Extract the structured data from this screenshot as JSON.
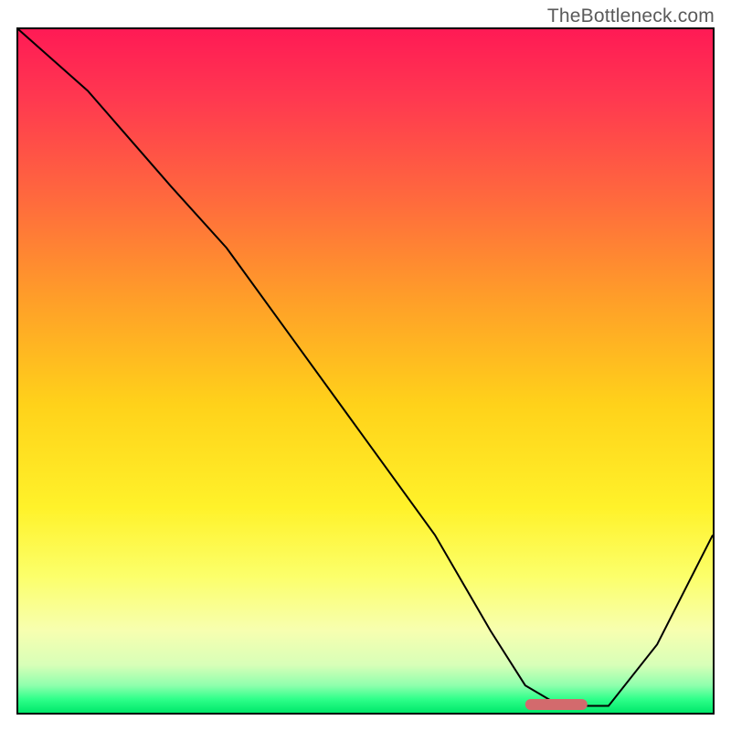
{
  "watermark": "TheBottleneck.com",
  "chart_data": {
    "type": "line",
    "title": "",
    "xlabel": "",
    "ylabel": "",
    "xlim": [
      0,
      100
    ],
    "ylim": [
      0,
      100
    ],
    "series": [
      {
        "name": "curve",
        "x": [
          0,
          10,
          22,
          30,
          40,
          50,
          60,
          68,
          73,
          78,
          85,
          92,
          100
        ],
        "y": [
          100,
          91,
          77,
          68,
          54,
          40,
          26,
          12,
          4,
          1,
          1,
          10,
          26
        ]
      }
    ],
    "marker": {
      "x_start": 73,
      "x_end": 82,
      "y": 1.2
    },
    "gradient_stops": [
      {
        "pct": 0,
        "color": "#ff1a55"
      },
      {
        "pct": 50,
        "color": "#ffd21a"
      },
      {
        "pct": 88,
        "color": "#f7ffb0"
      },
      {
        "pct": 100,
        "color": "#00e86a"
      }
    ]
  }
}
